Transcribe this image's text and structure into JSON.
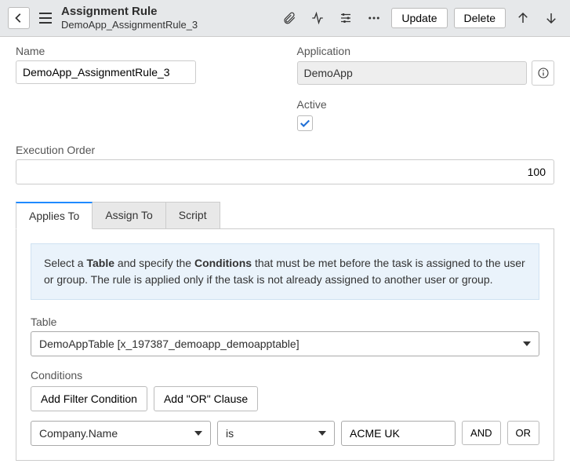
{
  "header": {
    "title": "Assignment Rule",
    "subtitle": "DemoApp_AssignmentRule_3",
    "update_label": "Update",
    "delete_label": "Delete"
  },
  "fields": {
    "name_label": "Name",
    "name_value": "DemoApp_AssignmentRule_3",
    "application_label": "Application",
    "application_value": "DemoApp",
    "active_label": "Active",
    "active_checked": true,
    "exec_label": "Execution Order",
    "exec_value": "100"
  },
  "tabs": {
    "applies_to": "Applies To",
    "assign_to": "Assign To",
    "script": "Script"
  },
  "panel": {
    "info_prefix": "Select a ",
    "info_b1": "Table",
    "info_mid": " and specify the ",
    "info_b2": "Conditions",
    "info_suffix": " that must be met before the task is assigned to the user or group. The rule is applied only if the task is not already assigned to another user or group.",
    "table_label": "Table",
    "table_value": "DemoAppTable [x_197387_demoapp_demoapptable]",
    "conditions_label": "Conditions",
    "add_filter_label": "Add Filter Condition",
    "add_or_label": "Add \"OR\" Clause",
    "cond_field": "Company.Name",
    "cond_op": "is",
    "cond_value": "ACME UK",
    "and_label": "AND",
    "or_label": "OR"
  }
}
